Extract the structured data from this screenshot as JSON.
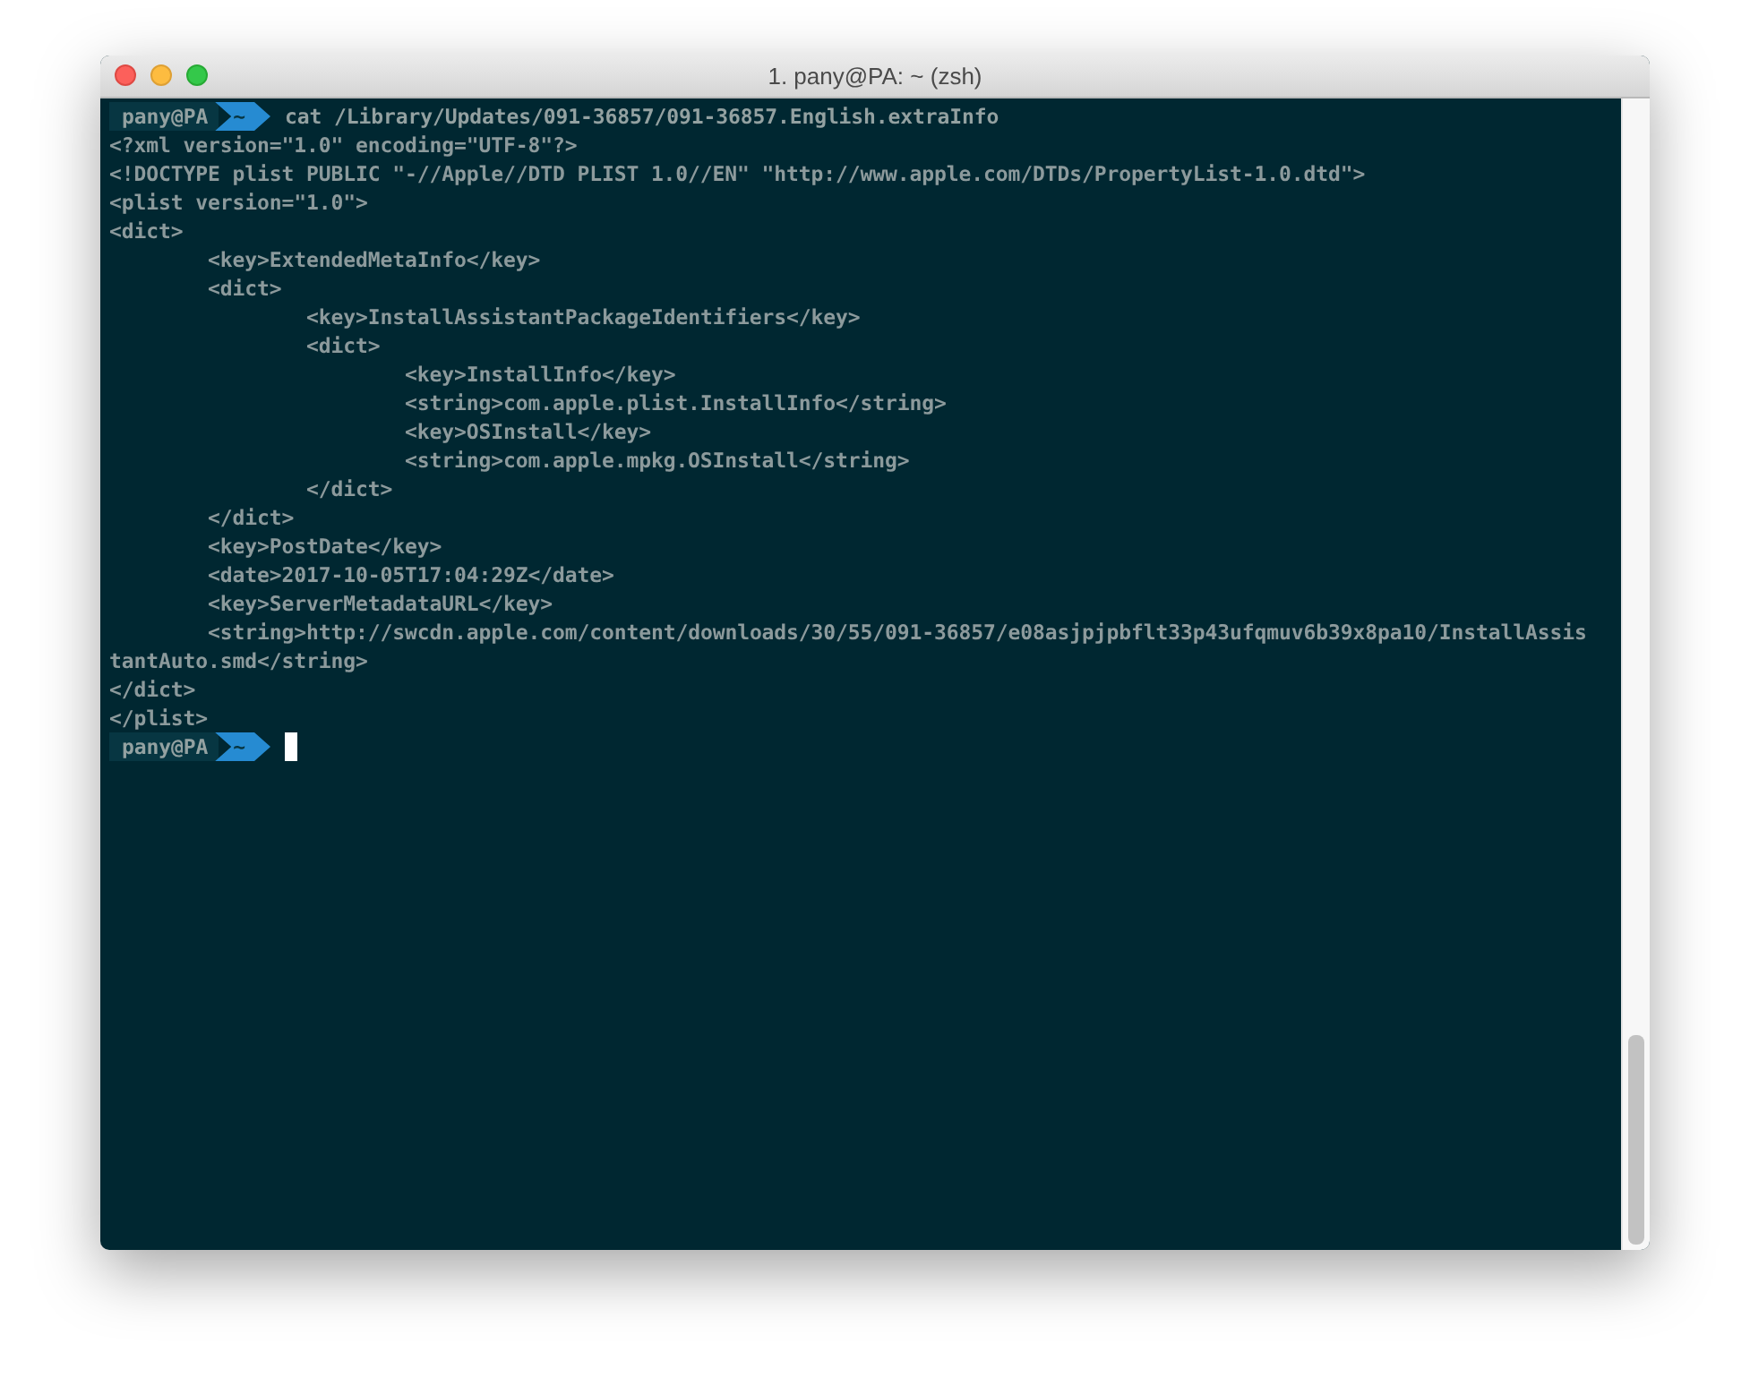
{
  "window": {
    "title": "1. pany@PA: ~ (zsh)"
  },
  "lines": [
    {
      "kind": "prompt",
      "user": "pany@PA",
      "dir": "~",
      "command": "cat /Library/Updates/091-36857/091-36857.English.extraInfo",
      "cursor": false
    },
    {
      "kind": "output",
      "text": "<?xml version=\"1.0\" encoding=\"UTF-8\"?>"
    },
    {
      "kind": "output",
      "text": "<!DOCTYPE plist PUBLIC \"-//Apple//DTD PLIST 1.0//EN\" \"http://www.apple.com/DTDs/PropertyList-1.0.dtd\">"
    },
    {
      "kind": "output",
      "text": "<plist version=\"1.0\">"
    },
    {
      "kind": "output",
      "text": "<dict>"
    },
    {
      "kind": "output",
      "text": "\t<key>ExtendedMetaInfo</key>"
    },
    {
      "kind": "output",
      "text": "\t<dict>"
    },
    {
      "kind": "output",
      "text": "\t\t<key>InstallAssistantPackageIdentifiers</key>"
    },
    {
      "kind": "output",
      "text": "\t\t<dict>"
    },
    {
      "kind": "output",
      "text": "\t\t\t<key>InstallInfo</key>"
    },
    {
      "kind": "output",
      "text": "\t\t\t<string>com.apple.plist.InstallInfo</string>"
    },
    {
      "kind": "output",
      "text": "\t\t\t<key>OSInstall</key>"
    },
    {
      "kind": "output",
      "text": "\t\t\t<string>com.apple.mpkg.OSInstall</string>"
    },
    {
      "kind": "output",
      "text": "\t\t</dict>"
    },
    {
      "kind": "output",
      "text": "\t</dict>"
    },
    {
      "kind": "output",
      "text": "\t<key>PostDate</key>"
    },
    {
      "kind": "output",
      "text": "\t<date>2017-10-05T17:04:29Z</date>"
    },
    {
      "kind": "output",
      "text": "\t<key>ServerMetadataURL</key>"
    },
    {
      "kind": "output",
      "text": "\t<string>http://swcdn.apple.com/content/downloads/30/55/091-36857/e08asjpjpbflt33p43ufqmuv6b39x8pa10/InstallAssis"
    },
    {
      "kind": "output",
      "text": "tantAuto.smd</string>"
    },
    {
      "kind": "output",
      "text": "</dict>"
    },
    {
      "kind": "output",
      "text": "</plist>"
    },
    {
      "kind": "prompt",
      "user": "pany@PA",
      "dir": "~",
      "cursor": true
    }
  ]
}
